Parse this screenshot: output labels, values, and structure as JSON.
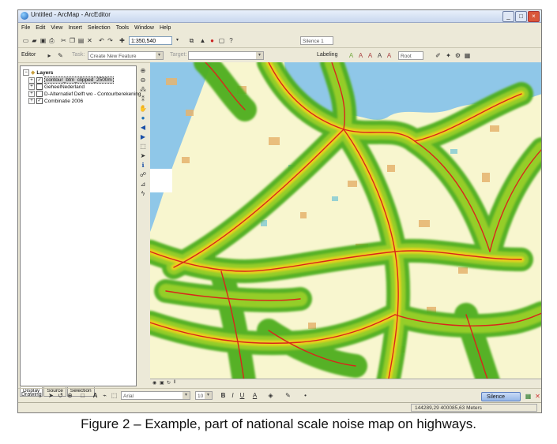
{
  "window": {
    "title": "Untitled - ArcMap - ArcEditor",
    "controls": [
      "_",
      "□",
      "×"
    ]
  },
  "menu": [
    "File",
    "Edit",
    "View",
    "Insert",
    "Selection",
    "Tools",
    "Window",
    "Help"
  ],
  "toolbar": {
    "scale": "1:350,540",
    "silence_dropdown": "Silence 1",
    "editor_label": "Editor",
    "task_label": "Task:",
    "task_value": "Create New Feature",
    "target_label": "Target:",
    "labeling_label": "Labeling",
    "label_combo": "Root"
  },
  "toc": {
    "root": "Layers",
    "layers": [
      {
        "label": "contour_btm_clipped_2500m",
        "checked": true,
        "selected": true
      },
      {
        "label": "GeheelNederland",
        "checked": false,
        "selected": false
      },
      {
        "label": "D-Alternatief Delft wo - Contourberekening",
        "checked": false,
        "selected": false
      },
      {
        "label": "Combinatie 2006",
        "checked": true,
        "selected": false
      }
    ],
    "tabs": [
      "Display",
      "Source",
      "Selection"
    ]
  },
  "drawing": {
    "drawing_label": "Drawing",
    "font": "Arial",
    "size": "10",
    "bold": "B",
    "italic": "I",
    "underline": "U",
    "silence_button": "Silence"
  },
  "status": {
    "coords": "144289,29  400085,63 Meters"
  },
  "caption": "Figure 2 – Example, part of national scale noise map on highways.",
  "colors": {
    "land": "#f8f6cf",
    "water": "#8fc7e8",
    "noise_outer": "#4fae1c",
    "noise_mid": "#9bd12a",
    "noise_inner": "#f2d21a",
    "road": "#d9251b",
    "urban": "#e6b46e"
  }
}
